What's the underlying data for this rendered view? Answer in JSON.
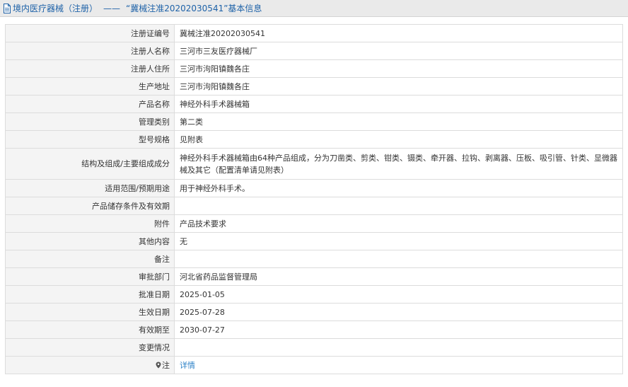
{
  "header": {
    "icon": "document-icon",
    "category": "境内医疗器械（注册）",
    "separator": "——",
    "heading": "“冀械注准20202030541”基本信息"
  },
  "details": {
    "rows": [
      {
        "label": "注册证编号",
        "value": "冀械注准20202030541"
      },
      {
        "label": "注册人名称",
        "value": "三河市三友医疗器械厂"
      },
      {
        "label": "注册人住所",
        "value": "三河市泃阳镇魏各庄"
      },
      {
        "label": "生产地址",
        "value": "三河市泃阳镇魏各庄"
      },
      {
        "label": "产品名称",
        "value": "神经外科手术器械箱"
      },
      {
        "label": "管理类别",
        "value": "第二类"
      },
      {
        "label": "型号规格",
        "value": "见附表"
      },
      {
        "label": "结构及组成/主要组成成分",
        "value": "神经外科手术器械箱由64种产品组成，分为刀凿类、剪类、钳类、镊类、牵开器、拉钩、剥离器、压板、吸引管、针类、显微器械及其它（配置清单请见附表）"
      },
      {
        "label": "适用范围/预期用途",
        "value": "用于神经外科手术。"
      },
      {
        "label": "产品储存条件及有效期",
        "value": ""
      },
      {
        "label": "附件",
        "value": "产品技术要求"
      },
      {
        "label": "其他内容",
        "value": "无"
      },
      {
        "label": "备注",
        "value": ""
      },
      {
        "label": "审批部门",
        "value": "河北省药品监督管理局"
      },
      {
        "label": "批准日期",
        "value": "2025-01-05"
      },
      {
        "label": "生效日期",
        "value": "2025-07-28"
      },
      {
        "label": "有效期至",
        "value": "2030-07-27"
      },
      {
        "label": "变更情况",
        "value": ""
      },
      {
        "label": "注",
        "value": "详情",
        "icon": "map-pin-icon"
      }
    ]
  },
  "colors": {
    "title_text": "#1e62a8",
    "link": "#2f83c8",
    "label_bg": "#f4f4f4",
    "border": "#dcdcdc"
  }
}
